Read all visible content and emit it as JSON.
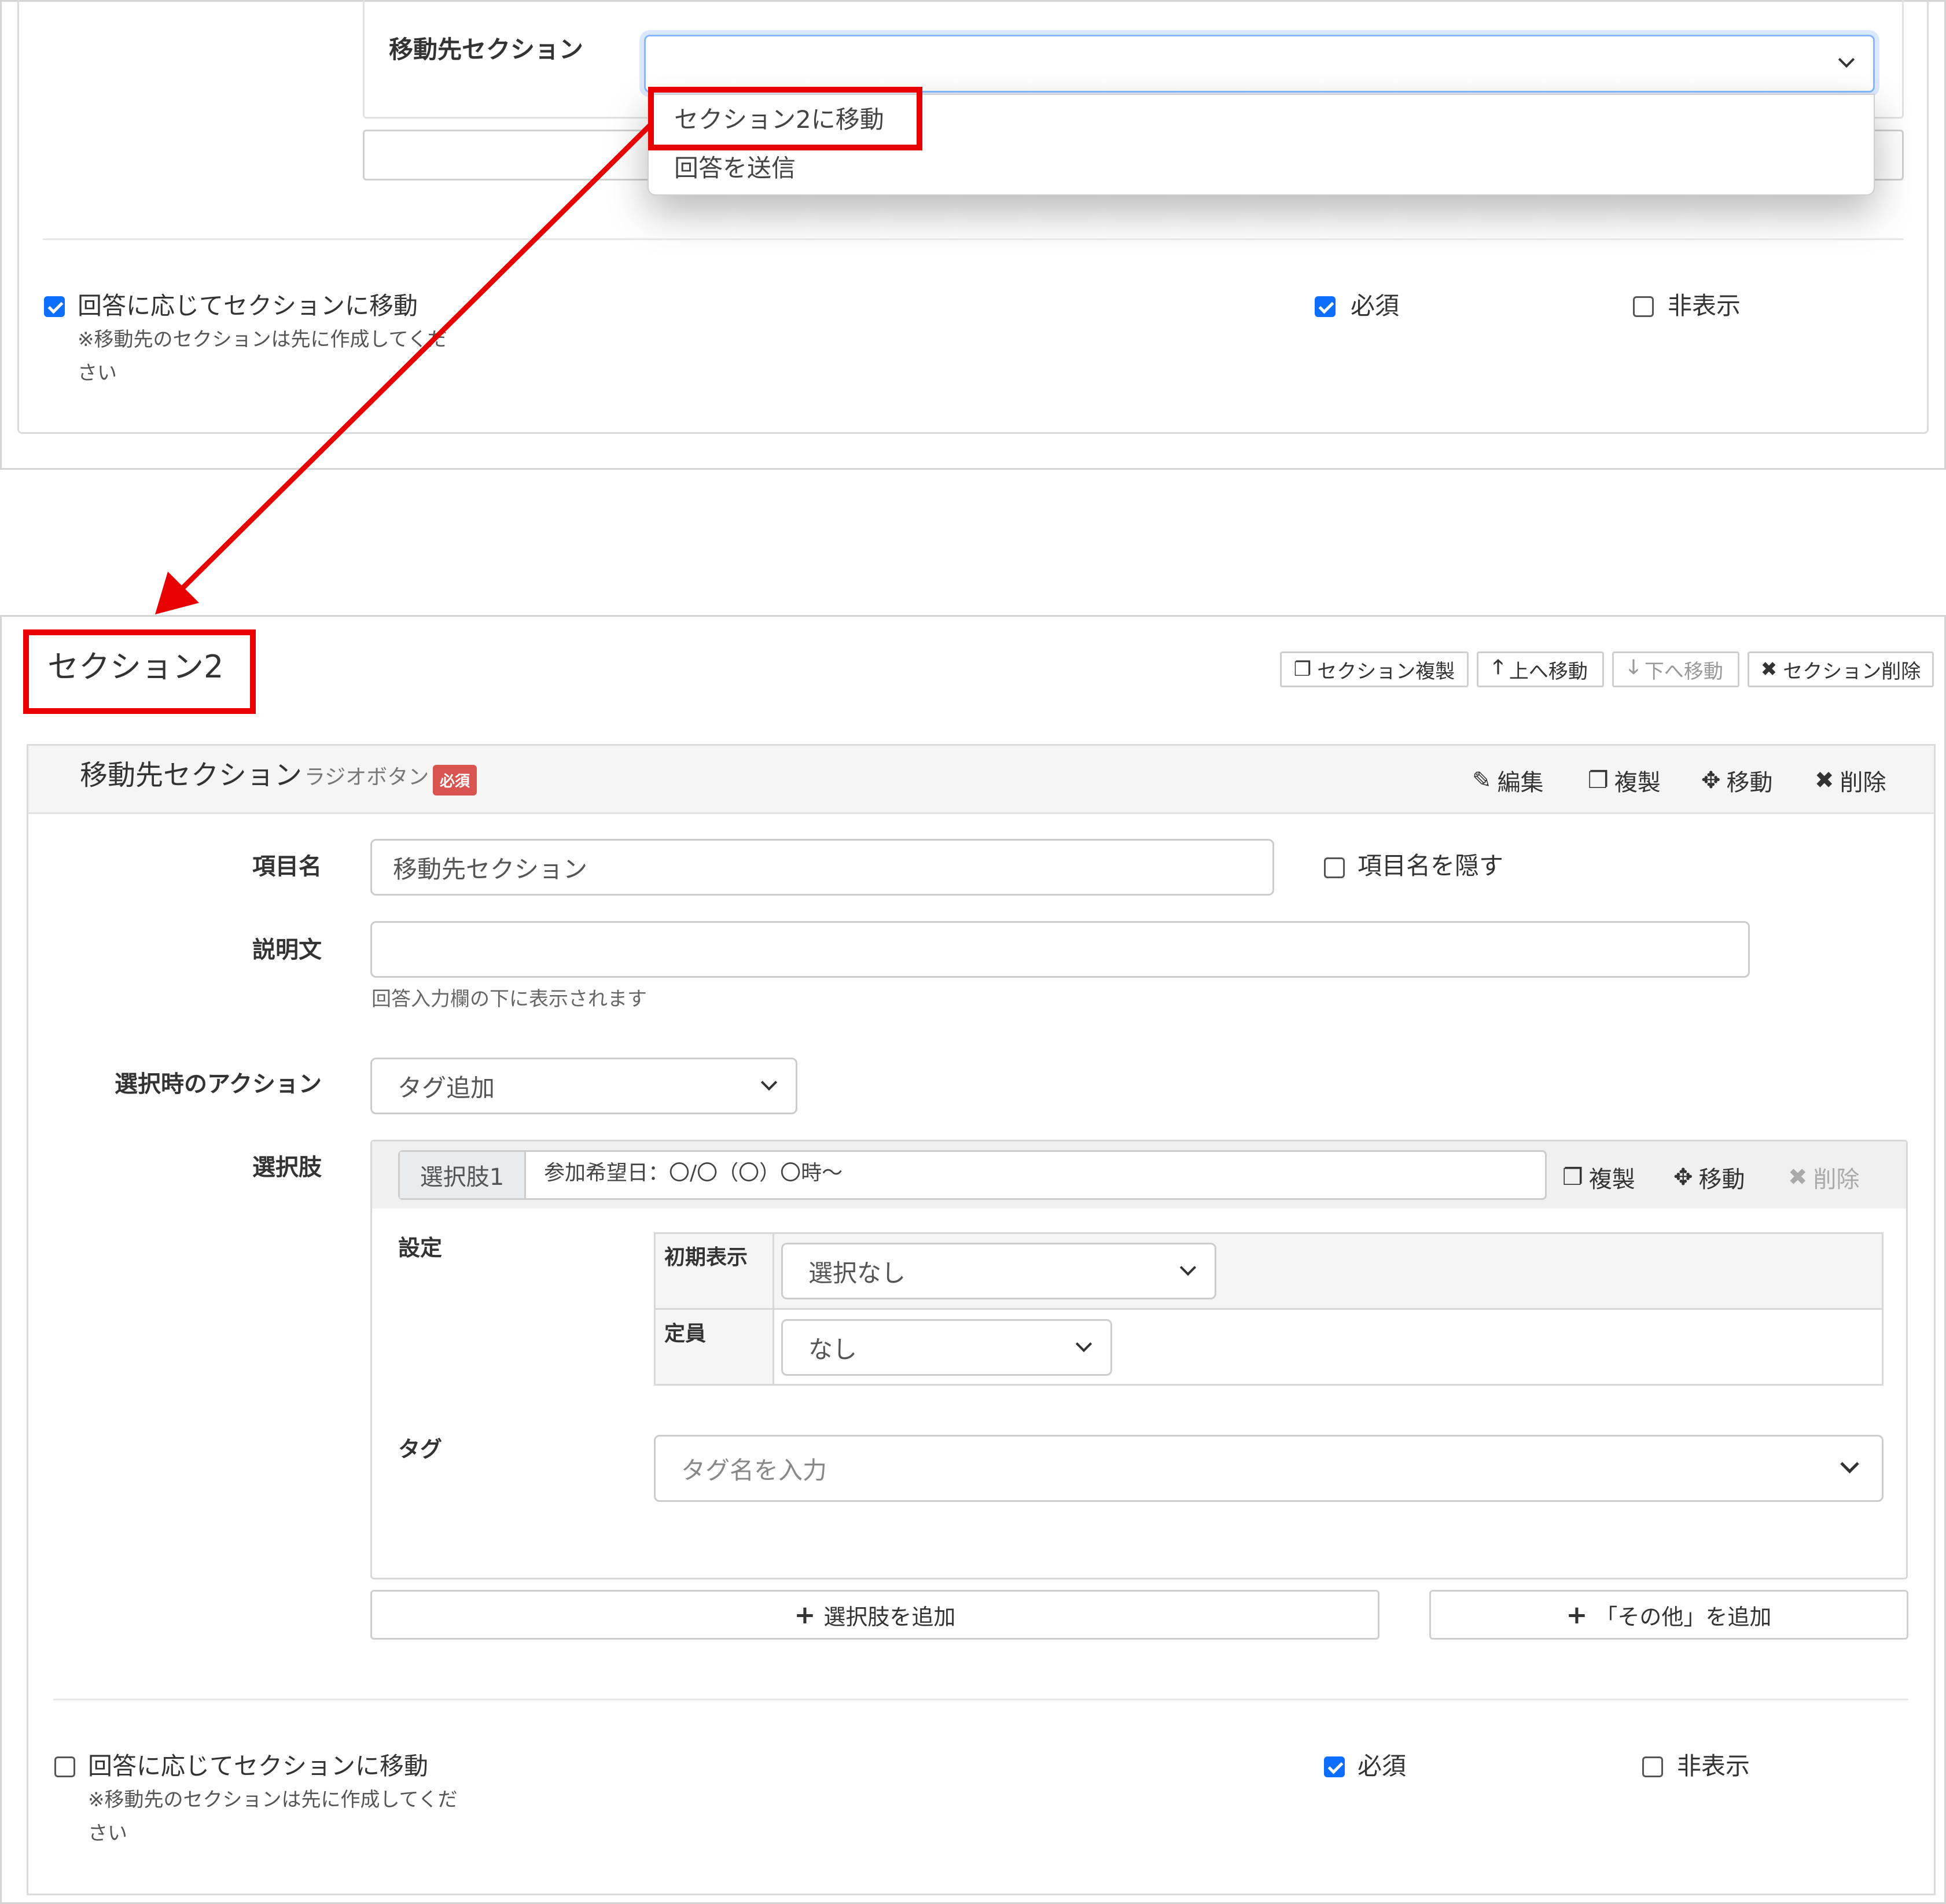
{
  "top_panel": {
    "destination_label": "移動先セクション",
    "dropdown_options": [
      "セクション2に移動",
      "回答を送信"
    ],
    "jump_checkbox_label": "回答に応じてセクションに移動",
    "jump_checkbox_checked": true,
    "note_line1": "※移動先のセクションは先に作成してくだ",
    "note_line2": "さい",
    "required_label": "必須",
    "required_checked": true,
    "hidden_label": "非表示",
    "hidden_checked": false
  },
  "section": {
    "title": "セクション2",
    "buttons": [
      {
        "icon": "copy-icon",
        "label": "セクション複製",
        "enabled": true
      },
      {
        "icon": "arrow-up-icon",
        "label": "上へ移動",
        "enabled": true
      },
      {
        "icon": "arrow-down-icon",
        "label": "下へ移動",
        "enabled": false
      },
      {
        "icon": "close-icon",
        "label": "セクション削除",
        "enabled": true
      }
    ]
  },
  "field": {
    "header_title": "移動先セクション",
    "header_type": "ラジオボタン",
    "header_badge": "必須",
    "header_actions": [
      {
        "icon": "pencil-icon",
        "label": "編集"
      },
      {
        "icon": "copy-icon",
        "label": "複製"
      },
      {
        "icon": "move-icon",
        "label": "移動"
      },
      {
        "icon": "close-icon",
        "label": "削除"
      }
    ],
    "item_name_label": "項目名",
    "item_name_value": "移動先セクション",
    "hide_item_name_label": "項目名を隠す",
    "description_label": "説明文",
    "description_value": "",
    "description_help": "回答入力欄の下に表示されます",
    "action_label": "選択時のアクション",
    "action_value": "タグ追加",
    "choices_label": "選択肢",
    "choice": {
      "addon": "選択肢1",
      "value": "参加希望日：〇/〇（〇）〇時～",
      "actions": [
        {
          "icon": "copy-icon",
          "label": "複製",
          "enabled": true
        },
        {
          "icon": "move-icon",
          "label": "移動",
          "enabled": true
        },
        {
          "icon": "close-icon",
          "label": "削除",
          "enabled": false
        }
      ],
      "settings_label": "設定",
      "initial_display_label": "初期表示",
      "initial_display_value": "選択なし",
      "capacity_label": "定員",
      "capacity_value": "なし",
      "tag_label": "タグ",
      "tag_placeholder": "タグ名を入力"
    },
    "add_choice_button": "選択肢を追加",
    "add_other_button": "「その他」を追加",
    "jump_checkbox_label": "回答に応じてセクションに移動",
    "jump_checkbox_checked": false,
    "note_line1": "※移動先のセクションは先に作成してくだ",
    "note_line2": "さい",
    "required_label": "必須",
    "required_checked": true,
    "hidden_label": "非表示",
    "hidden_checked": false
  },
  "colors": {
    "annotation_red": "#e60000",
    "checkbox_blue": "#0d6efd",
    "badge_red": "#d9534f"
  }
}
